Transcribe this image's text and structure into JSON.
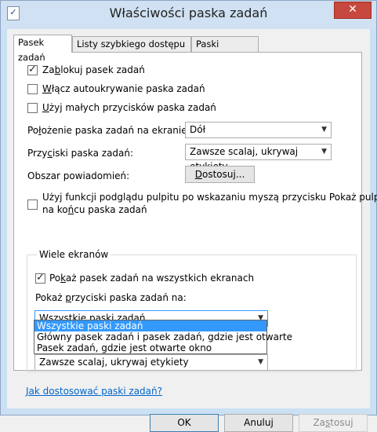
{
  "window": {
    "title": "Właściwości paska zadań",
    "close_glyph": "✕",
    "icon_glyph": "✓"
  },
  "tabs": [
    {
      "label": "Pasek zadań",
      "active": true
    },
    {
      "label": "Listy szybkiego dostępu",
      "active": false
    },
    {
      "label": "Paski narzędzi",
      "active": false
    }
  ],
  "options": {
    "lock": {
      "pre": "Za",
      "u": "b",
      "post": "lokuj pasek zadań",
      "checked": true
    },
    "autohide": {
      "pre": "",
      "u": "W",
      "post": "łącz autoukrywanie paska zadań",
      "checked": false
    },
    "small": {
      "pre": "",
      "u": "U",
      "post": "żyj małych przycisków paska zadań",
      "checked": false
    }
  },
  "position": {
    "label_pre": "Po",
    "label_u": "ł",
    "label_post": "ożenie paska zadań na ekranie:",
    "value": "Dół"
  },
  "buttons_mode": {
    "label_pre": "Przy",
    "label_u": "c",
    "label_post": "iski paska zadań:",
    "value": "Zawsze scalaj, ukrywaj etykiety"
  },
  "notification": {
    "label": "Obszar powiadomień:",
    "button_pre": "",
    "button_u": "D",
    "button_post": "ostosuj..."
  },
  "peek": {
    "line1_pre": "Użyj funkcji podglądu pulpitu po wskazaniu myszą przycisku Pokaż pulpit",
    "line2_pre": "na ko",
    "line2_u": "ń",
    "line2_post": "cu paska zadań",
    "checked": false
  },
  "multi": {
    "group_title": "Wiele ekranów",
    "show_all": {
      "pre": "Po",
      "u": "k",
      "post": "aż pasek zadań na wszystkich ekranach",
      "checked": true
    },
    "show_buttons_label_pre": "Pokaż ",
    "show_buttons_label_u": "p",
    "show_buttons_label_post": "rzyciski paska zadań na:",
    "show_buttons_value": "Wszystkie paski zadań",
    "dropdown_options": [
      "Wszystkie paski zadań",
      "Główny pasek zadań i pasek zadań, gdzie jest otwarte",
      "Pasek zadań, gdzie jest otwarte okno"
    ],
    "hidden_combo_value": "Zawsze scalaj, ukrywaj etykiety"
  },
  "help_link": "Jak dostosować paski zadań?",
  "footer": {
    "ok": "OK",
    "cancel": "Anuluj",
    "apply_pre": "Za",
    "apply_u": "s",
    "apply_post": "tosuj"
  }
}
